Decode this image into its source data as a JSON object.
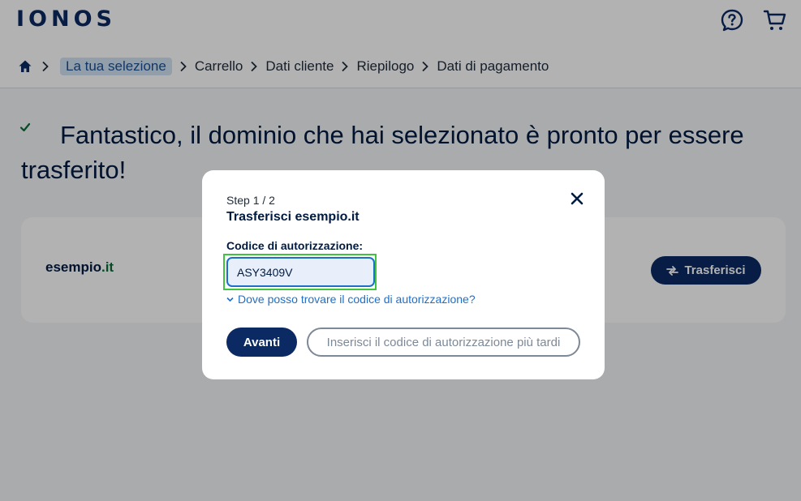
{
  "header": {
    "logo": "IONOS",
    "icons": [
      "help-chat-icon",
      "shopping-cart-icon"
    ]
  },
  "breadcrumb": {
    "home_icon": "home-icon",
    "items": [
      "La tua selezione",
      "Carrello",
      "Dati cliente",
      "Riepilogo",
      "Dati di pagamento"
    ]
  },
  "main": {
    "check_icon": "check-icon",
    "heading": "Fantastico, il dominio che hai selezionato è pronto per essere trasferito!",
    "domain": {
      "name": "esempio",
      "tld": ".it"
    },
    "transfer_button": "Trasferisci"
  },
  "modal": {
    "step": "Step 1 / 2",
    "title": "Trasferisci esempio.it",
    "field_label": "Codice di autorizzazione:",
    "auth_code_value": "ASY3409V",
    "help_link": "Dove posso trovare il codice di autorizzazione?",
    "next_button": "Avanti",
    "later_button": "Inserisci il codice di autorizzazione più tardi"
  },
  "colors": {
    "brand": "#0b2a63",
    "link": "#1f6fc9",
    "tld_green": "#0a6b3a",
    "focus_ring": "#3fc43f"
  }
}
